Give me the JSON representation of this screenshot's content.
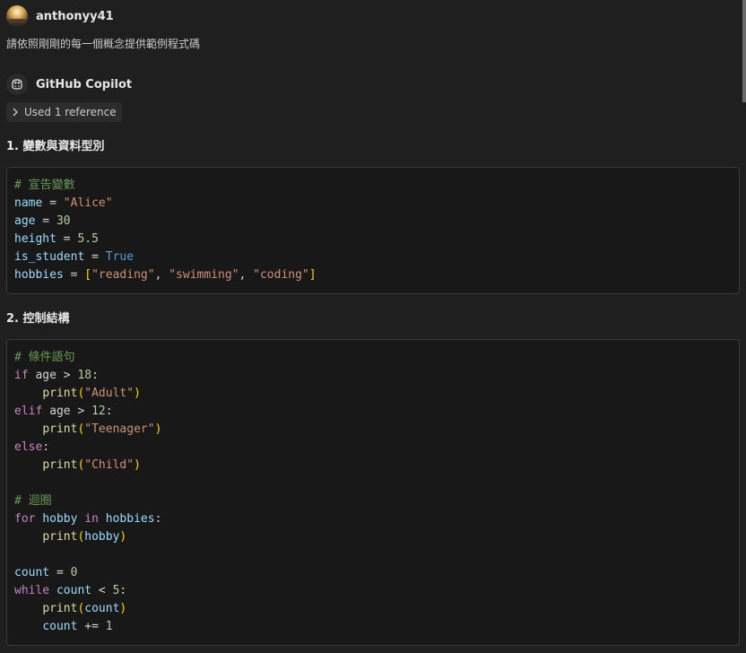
{
  "user": {
    "name": "anthonyy41",
    "message": "請依照剛剛的每一個概念提供範例程式碼"
  },
  "assistant": {
    "name": "GitHub Copilot",
    "reference_label": "Used 1 reference"
  },
  "sections": [
    {
      "title": "1. 變數與資料型別",
      "code": [
        [
          [
            "c",
            "# 宣告變數"
          ]
        ],
        [
          [
            "v",
            "name"
          ],
          [
            "o",
            " = "
          ],
          [
            "s",
            "\"Alice\""
          ]
        ],
        [
          [
            "v",
            "age"
          ],
          [
            "o",
            " = "
          ],
          [
            "n",
            "30"
          ]
        ],
        [
          [
            "v",
            "height"
          ],
          [
            "o",
            " = "
          ],
          [
            "n",
            "5.5"
          ]
        ],
        [
          [
            "v",
            "is_student"
          ],
          [
            "o",
            " = "
          ],
          [
            "k",
            "True"
          ]
        ],
        [
          [
            "v",
            "hobbies"
          ],
          [
            "o",
            " = "
          ],
          [
            "b",
            "["
          ],
          [
            "s",
            "\"reading\""
          ],
          [
            "o",
            ", "
          ],
          [
            "s",
            "\"swimming\""
          ],
          [
            "o",
            ", "
          ],
          [
            "s",
            "\"coding\""
          ],
          [
            "b",
            "]"
          ]
        ]
      ]
    },
    {
      "title": "2. 控制結構",
      "code": [
        [
          [
            "c",
            "# 條件語句"
          ]
        ],
        [
          [
            "kw",
            "if"
          ],
          [
            "p",
            " age "
          ],
          [
            "o",
            ">"
          ],
          [
            "p",
            " "
          ],
          [
            "n",
            "18"
          ],
          [
            "p",
            ":"
          ]
        ],
        [
          [
            "p",
            "    "
          ],
          [
            "f",
            "print"
          ],
          [
            "b",
            "("
          ],
          [
            "s",
            "\"Adult\""
          ],
          [
            "b",
            ")"
          ]
        ],
        [
          [
            "kw",
            "elif"
          ],
          [
            "p",
            " age "
          ],
          [
            "o",
            ">"
          ],
          [
            "p",
            " "
          ],
          [
            "n",
            "12"
          ],
          [
            "p",
            ":"
          ]
        ],
        [
          [
            "p",
            "    "
          ],
          [
            "f",
            "print"
          ],
          [
            "b",
            "("
          ],
          [
            "s",
            "\"Teenager\""
          ],
          [
            "b",
            ")"
          ]
        ],
        [
          [
            "kw",
            "else"
          ],
          [
            "p",
            ":"
          ]
        ],
        [
          [
            "p",
            "    "
          ],
          [
            "f",
            "print"
          ],
          [
            "b",
            "("
          ],
          [
            "s",
            "\"Child\""
          ],
          [
            "b",
            ")"
          ]
        ],
        [],
        [
          [
            "c",
            "# 迴圈"
          ]
        ],
        [
          [
            "kw",
            "for"
          ],
          [
            "p",
            " "
          ],
          [
            "v",
            "hobby"
          ],
          [
            "p",
            " "
          ],
          [
            "kw",
            "in"
          ],
          [
            "p",
            " "
          ],
          [
            "v",
            "hobbies"
          ],
          [
            "p",
            ":"
          ]
        ],
        [
          [
            "p",
            "    "
          ],
          [
            "f",
            "print"
          ],
          [
            "b",
            "("
          ],
          [
            "v",
            "hobby"
          ],
          [
            "b",
            ")"
          ]
        ],
        [],
        [
          [
            "v",
            "count"
          ],
          [
            "o",
            " = "
          ],
          [
            "n",
            "0"
          ]
        ],
        [
          [
            "kw",
            "while"
          ],
          [
            "p",
            " "
          ],
          [
            "v",
            "count"
          ],
          [
            "o",
            " < "
          ],
          [
            "n",
            "5"
          ],
          [
            "p",
            ":"
          ]
        ],
        [
          [
            "p",
            "    "
          ],
          [
            "f",
            "print"
          ],
          [
            "b",
            "("
          ],
          [
            "v",
            "count"
          ],
          [
            "b",
            ")"
          ]
        ],
        [
          [
            "p",
            "    "
          ],
          [
            "v",
            "count"
          ],
          [
            "o",
            " += "
          ],
          [
            "n",
            "1"
          ]
        ]
      ]
    }
  ]
}
